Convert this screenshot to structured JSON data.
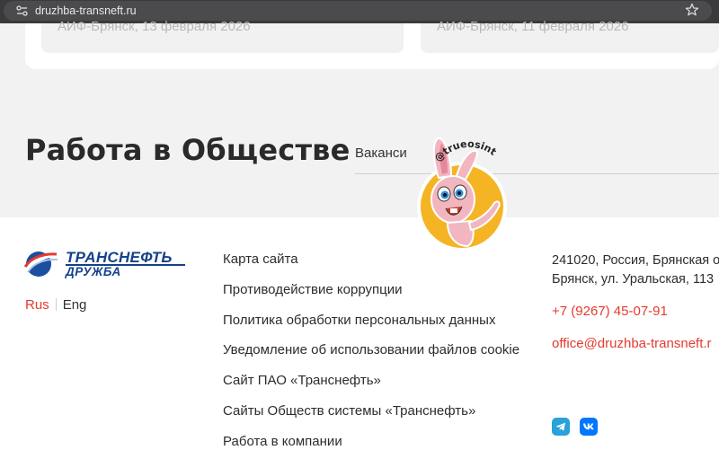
{
  "browser": {
    "url": "druzhba-transneft.ru"
  },
  "news": {
    "cards": [
      {
        "meta": "АИФ-Брянск, 13 февраля 2026"
      },
      {
        "meta": "АИФ-Брянск, 11 февраля 2026"
      }
    ]
  },
  "work": {
    "title": "Работа в Обществе",
    "vacancy_link": "Ваканси"
  },
  "sticker": {
    "handle": "@trueosint"
  },
  "footer": {
    "logo": {
      "name": "ТРАНСНЕФТЬ",
      "sub": "ДРУЖБА"
    },
    "lang": {
      "rus": "Rus",
      "eng": "Eng"
    },
    "links": [
      "Карта сайта",
      "Противодействие коррупции",
      "Политика обработки персональных данных",
      "Уведомление об использовании файлов cookie",
      "Сайт ПАО «Транснефть»",
      "Сайты Обществ системы «Транснефть»",
      "Работа в компании"
    ],
    "address_line1": "241020, Россия, Брянская о",
    "address_line2": "Брянск, ул. Уральская, 113",
    "phone": "+7 (9267) 45-07-91",
    "email": "office@druzhba-transneft.r"
  },
  "colors": {
    "accent_red": "#e53a2e",
    "brand_blue": "#14418b",
    "telegram": "#2aa1da",
    "vk": "#0077ff"
  },
  "icons": {
    "site_info": "site-settings-icon",
    "bookmark": "star-icon",
    "telegram": "telegram-icon",
    "vk": "vk-icon"
  }
}
